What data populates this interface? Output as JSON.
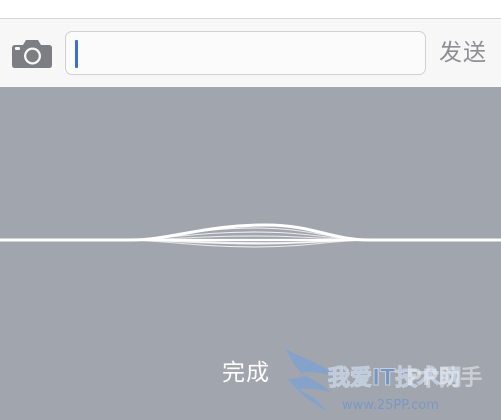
{
  "input_bar": {
    "camera_icon": "camera-icon",
    "text_value": "",
    "send_label": "发送"
  },
  "dictation": {
    "done_label": "完成"
  },
  "watermark": {
    "line1": "我爱IT技术网",
    "line2": "PP助手",
    "url": "www.25PP.com"
  },
  "colors": {
    "panel_background": "#a1a6ae",
    "caret": "#3b6fd3",
    "send_text": "#8e8e93",
    "watermark": "#5b8fd6"
  }
}
